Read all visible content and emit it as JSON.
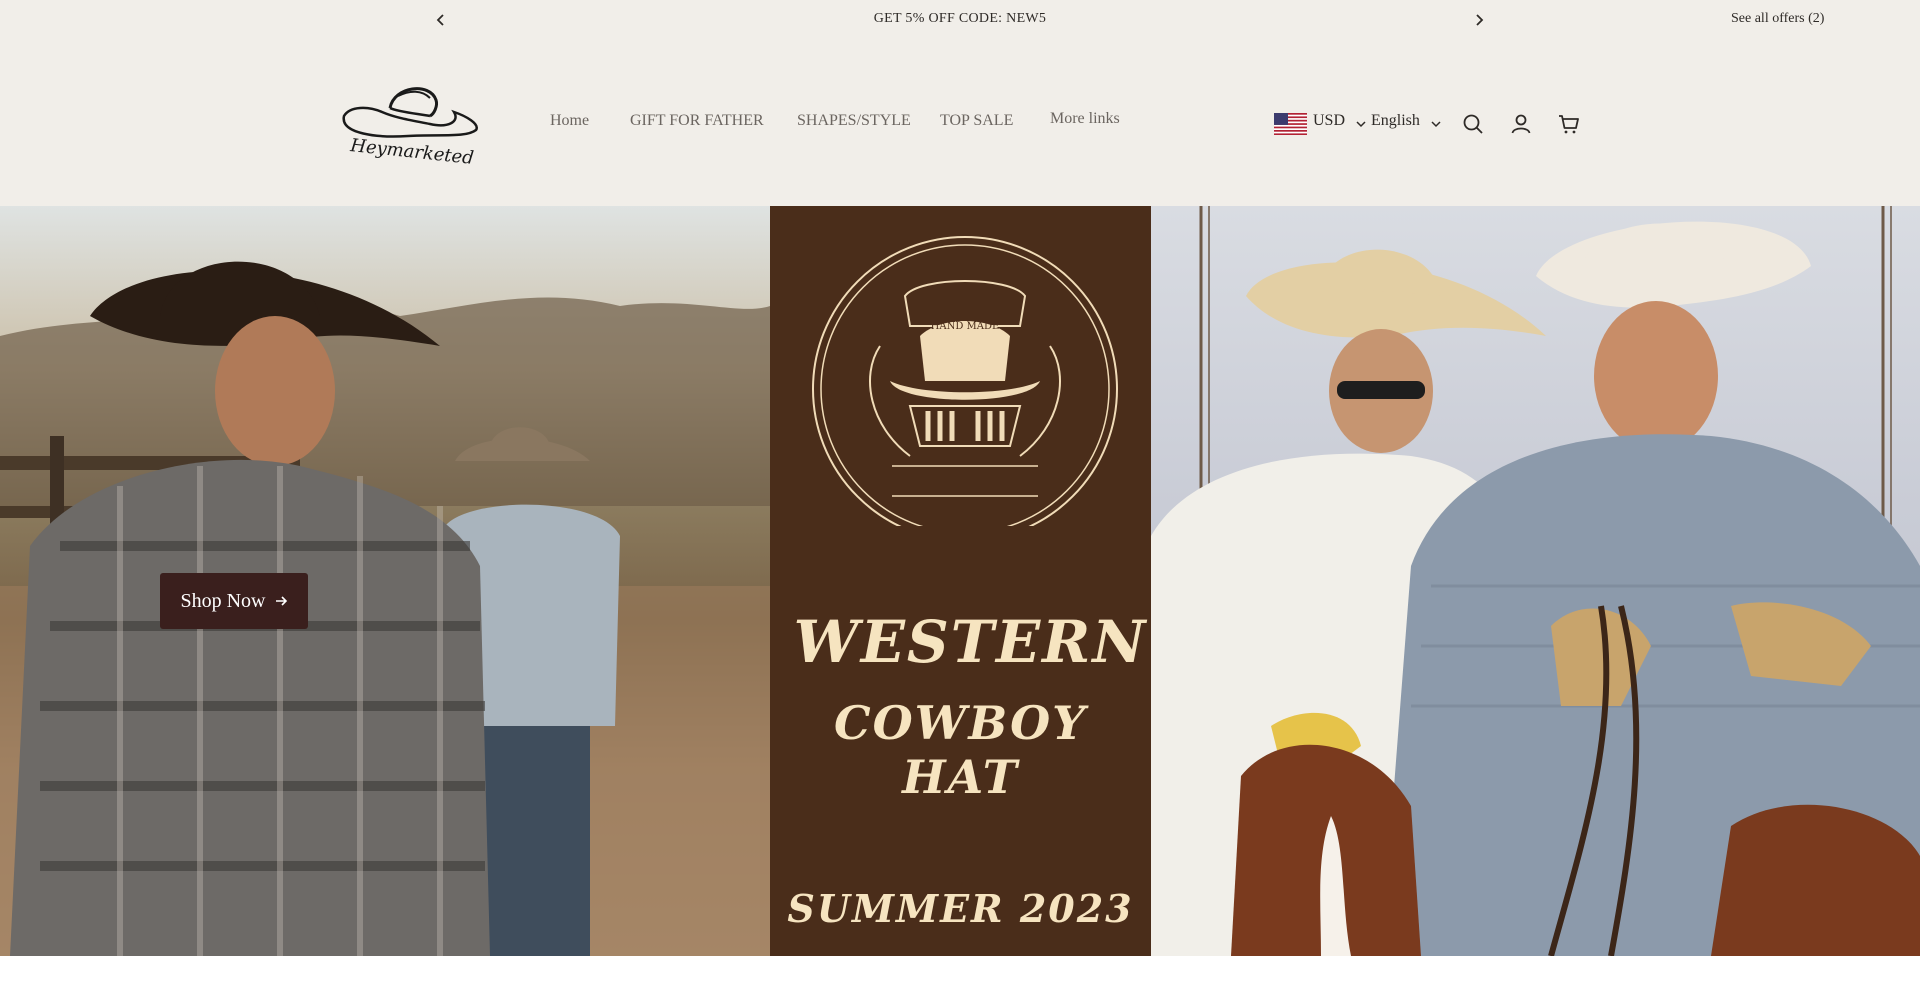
{
  "announcement": {
    "message": "GET 5% OFF CODE: NEW5",
    "offers_link": "See all offers (2)"
  },
  "header": {
    "logo_text": "Heymarketed",
    "nav": [
      {
        "label": "Home"
      },
      {
        "label": "GIFT FOR FATHER"
      },
      {
        "label": "SHAPES/STYLE"
      },
      {
        "label": "TOP SALE"
      },
      {
        "label": "More links"
      }
    ],
    "currency": "USD",
    "language": "English",
    "icons": [
      "search-icon",
      "account-icon",
      "cart-icon"
    ]
  },
  "hero": {
    "cta_label": "Shop Now",
    "badge_text": "HAND MADE",
    "headline_1": "WESTERN",
    "headline_2": "COWBOY HAT",
    "headline_3": "SUMMER 2023"
  },
  "colors": {
    "page_bg": "#f1eee9",
    "cta_bg": "#3a1f1d",
    "mid_panel_bg": "#4a2d1a",
    "headline": "#f6e4c0"
  }
}
